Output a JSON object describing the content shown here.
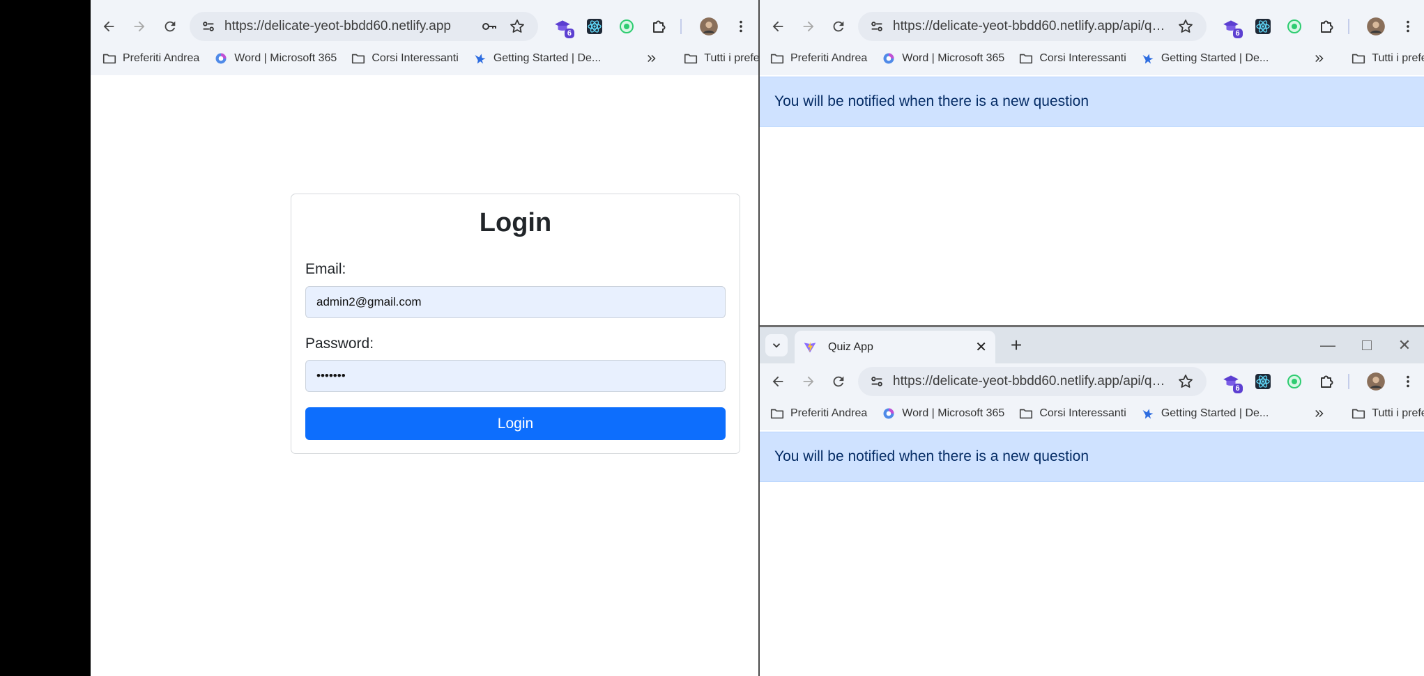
{
  "left_window": {
    "url": "https://delicate-yeot-bbdd60.netlify.app",
    "extensions": {
      "badge_count": "6"
    },
    "bookmarks": [
      {
        "label": "Preferiti Andrea",
        "icon": "folder-icon"
      },
      {
        "label": "Word | Microsoft 365",
        "icon": "m365-icon"
      },
      {
        "label": "Corsi Interessanti",
        "icon": "folder-icon"
      },
      {
        "label": "Getting Started | De...",
        "icon": "bird-icon"
      }
    ],
    "all_bookmarks_label": "Tutti i preferiti",
    "login": {
      "title": "Login",
      "email_label": "Email:",
      "email_value": "admin2@gmail.com",
      "password_label": "Password:",
      "password_value": "•••••••",
      "button_label": "Login"
    }
  },
  "top_right_window": {
    "url": "https://delicate-yeot-bbdd60.netlify.app/api/quizz...",
    "extensions": {
      "badge_count": "6"
    },
    "bookmarks": [
      {
        "label": "Preferiti Andrea",
        "icon": "folder-icon"
      },
      {
        "label": "Word | Microsoft 365",
        "icon": "m365-icon"
      },
      {
        "label": "Corsi Interessanti",
        "icon": "folder-icon"
      },
      {
        "label": "Getting Started | De...",
        "icon": "bird-icon"
      }
    ],
    "all_bookmarks_label": "Tutti i preferiti",
    "alert_text": "You will be notified when there is a new question"
  },
  "bottom_right_window": {
    "tab_title": "Quiz App",
    "url": "https://delicate-yeot-bbdd60.netlify.app/api/quizz...",
    "extensions": {
      "badge_count": "6"
    },
    "bookmarks": [
      {
        "label": "Preferiti Andrea",
        "icon": "folder-icon"
      },
      {
        "label": "Word | Microsoft 365",
        "icon": "m365-icon"
      },
      {
        "label": "Corsi Interessanti",
        "icon": "folder-icon"
      },
      {
        "label": "Getting Started | De...",
        "icon": "bird-icon"
      }
    ],
    "all_bookmarks_label": "Tutti i preferiti",
    "alert_text": "You will be notified when there is a new question"
  },
  "colors": {
    "primary_button": "#0d6efd",
    "alert_bg": "#cfe2ff",
    "alert_text": "#052c65",
    "autofill_bg": "#e8f0fe"
  }
}
